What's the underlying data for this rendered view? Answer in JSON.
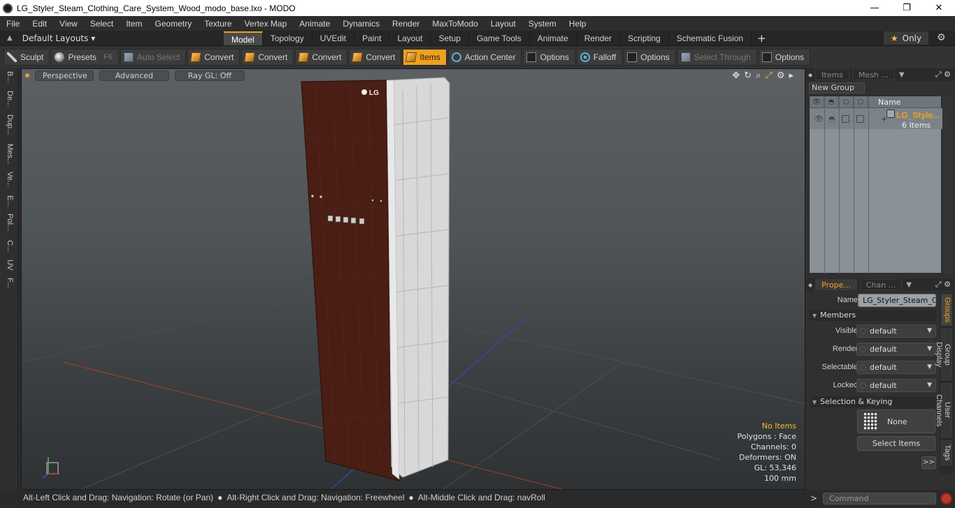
{
  "window": {
    "title": "LG_Styler_Steam_Clothing_Care_System_Wood_modo_base.lxo - MODO",
    "minimize": "—",
    "maximize": "❐",
    "close": "✕"
  },
  "menu": [
    "File",
    "Edit",
    "View",
    "Select",
    "Item",
    "Geometry",
    "Texture",
    "Vertex Map",
    "Animate",
    "Dynamics",
    "Render",
    "MaxToModo",
    "Layout",
    "System",
    "Help"
  ],
  "layouts": {
    "label": "Default Layouts ▾"
  },
  "tabs": [
    "Model",
    "Topology",
    "UVEdit",
    "Paint",
    "Layout",
    "Setup",
    "Game Tools",
    "Animate",
    "Render",
    "Scripting",
    "Schematic Fusion"
  ],
  "tabs_plus": "+",
  "only_label": "Only",
  "toolbar": {
    "sculpt": "Sculpt",
    "presets": "Presets",
    "presets_hotkey": "F6",
    "auto_select": "Auto Select",
    "convert1": "Convert",
    "convert2": "Convert",
    "convert3": "Convert",
    "convert4": "Convert",
    "items": "Items",
    "action_center": "Action Center",
    "options1": "Options",
    "falloff": "Falloff",
    "options2": "Options",
    "select_through": "Select Through",
    "options3": "Options"
  },
  "left_tabs": [
    "B...",
    "De...",
    "Dup...",
    "Mes...",
    "Ve...",
    "E...",
    "Pol...",
    "C...",
    "UV",
    "F..."
  ],
  "viewport": {
    "perspective": "Perspective",
    "advanced": "Advanced",
    "raygl": "Ray GL: Off",
    "model_logo": "LG",
    "stats": {
      "no_items": "No Items",
      "polygons": "Polygons : Face",
      "channels": "Channels: 0",
      "deformers": "Deformers: ON",
      "gl": "GL: 53,346",
      "scale": "100 mm"
    }
  },
  "status": {
    "hint1": "Alt-Left Click and Drag: Navigation: Rotate (or Pan)",
    "hint2": "Alt-Right Click and Drag: Navigation: Freewheel",
    "hint3": "Alt-Middle Click and Drag: navRoll",
    "command_placeholder": "Command"
  },
  "items_panel": {
    "tab_items": "Items",
    "tab_mesh": "Mesh ...",
    "new_group": "New Group",
    "col_name": "Name",
    "group_name": "LG_Style...",
    "group_count": "6 Items"
  },
  "properties": {
    "tab_prope": "Prope...",
    "tab_chan": "Chan ...",
    "name_label": "Name",
    "name_value": "LG_Styler_Steam_Clothing_Care_System_Wood",
    "members": "Members",
    "visible_label": "Visible",
    "visible_value": "default",
    "render_label": "Render",
    "render_value": "default",
    "selectable_label": "Selectable",
    "selectable_value": "default",
    "locked_label": "Locked",
    "locked_value": "default",
    "sel_keying": "Selection & Keying",
    "none_btn": "None",
    "select_items": "Select Items",
    "more": ">>",
    "vtabs": [
      "Groups",
      "Group Display",
      "User Channels",
      "Tags"
    ]
  }
}
